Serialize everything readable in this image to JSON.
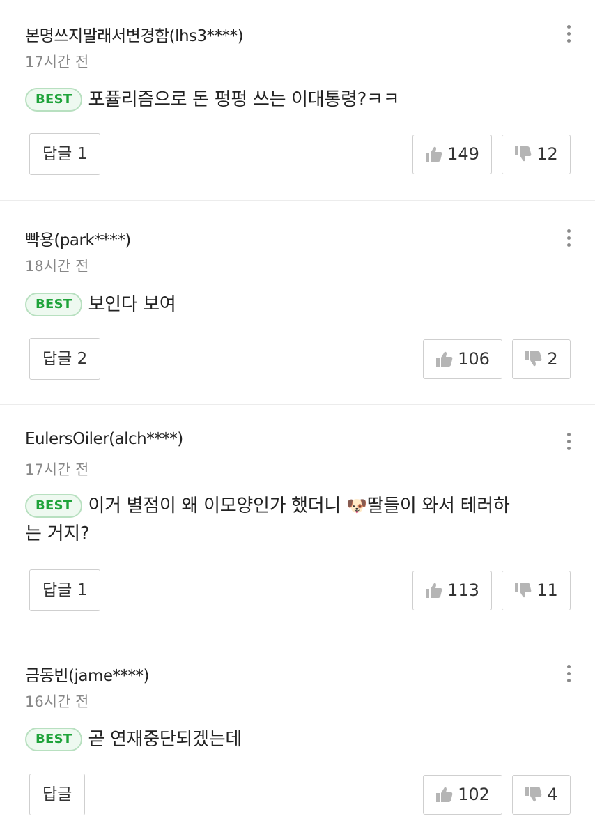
{
  "best_badge": "BEST",
  "icons": {
    "like": "thumbs-up-icon",
    "dislike": "thumbs-down-icon",
    "more": "more-vertical-icon"
  },
  "colors": {
    "best_text": "#1fa33a",
    "best_border": "#b8e0c0",
    "best_bg": "#eef9f0",
    "time_text": "#888888",
    "icon_gray": "#b5b5b5"
  },
  "comments": [
    {
      "author": "본명쓰지말래서변경함(lhs3****)",
      "time": "17시간 전",
      "text": "포퓰리즘으로 돈 펑펑 쓰는 이대통령?ㅋㅋ",
      "reply_label": "답글 1",
      "likes": "149",
      "dislikes": "12"
    },
    {
      "author": "빡용(park****)",
      "time": "18시간 전",
      "text": "보인다 보여",
      "reply_label": "답글 2",
      "likes": "106",
      "dislikes": "2"
    },
    {
      "author": "EulersOiler(alch****)",
      "time": "17시간 전",
      "text_part1": "이거 별점이 왜 이모양인가 했더니 ",
      "emoji": "🐶",
      "text_part2": "딸들이 와서 테러하는 거지?",
      "reply_label": "답글 1",
      "likes": "113",
      "dislikes": "11"
    },
    {
      "author": "금동빈(jame****)",
      "time": "16시간 전",
      "text": "곧 연재중단되겠는데",
      "reply_label": "답글",
      "likes": "102",
      "dislikes": "4"
    }
  ]
}
